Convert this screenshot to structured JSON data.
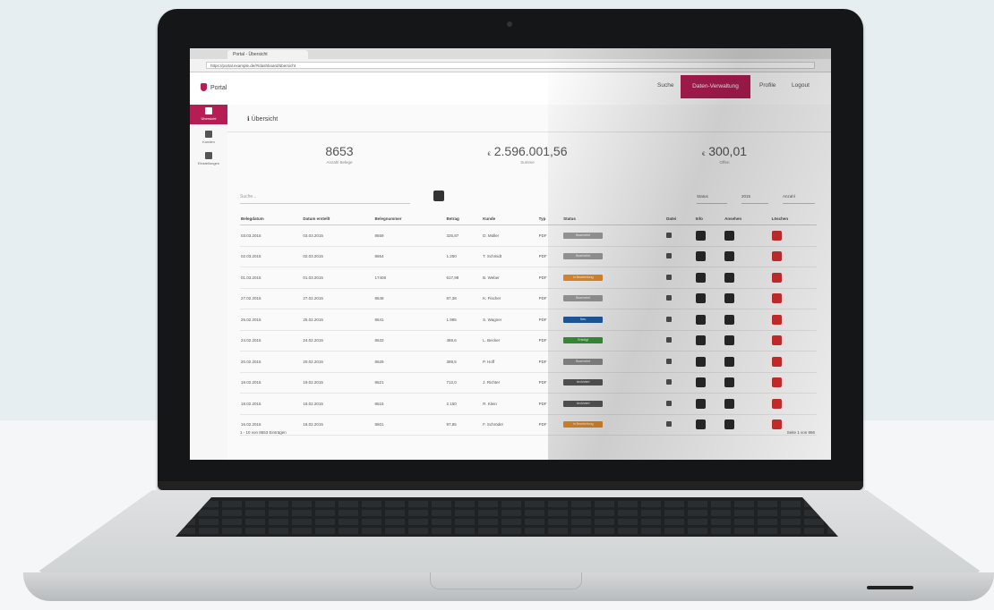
{
  "browser": {
    "tab_title": "Portal - Übersicht",
    "url": "https://portal.example.de/#/dashboard/übersicht"
  },
  "navbar": {
    "brand": "Portal",
    "links": [
      "Suche",
      "Daten-Verwaltung",
      "Profile",
      "Logout"
    ],
    "active_index": 1
  },
  "sidebar": {
    "items": [
      "Übersicht",
      "Kunden",
      "Einstellungen"
    ],
    "active_index": 0
  },
  "breadcrumb": "Übersicht",
  "stats": [
    {
      "value": "8653",
      "label": "Anzahl Belege"
    },
    {
      "value": "2.596.001,56",
      "label": "Summe",
      "prefix": "€"
    },
    {
      "value": "300,01",
      "label": "Offen",
      "prefix": "€"
    }
  ],
  "search": {
    "placeholder": "Suche..."
  },
  "filters": [
    "Status",
    "2015",
    "Anzahl"
  ],
  "table": {
    "columns": [
      "Belegdatum",
      "Datum erstellt",
      "Belegnummer",
      "Betrag",
      "Kunde",
      "Typ",
      "Status",
      "Datei",
      "Info",
      "Ansehen",
      "Löschen"
    ],
    "rows": [
      {
        "belegdatum": "03.03.2015",
        "erstellt": "03.03.2015",
        "nummer": "8659",
        "betrag": "325,87",
        "kunde": "D. Müller",
        "typ": "PDF",
        "status": "Bearbeitet",
        "status_color": "#9e9e9e"
      },
      {
        "belegdatum": "02.03.2015",
        "erstellt": "02.03.2015",
        "nummer": "8654",
        "betrag": "1.250",
        "kunde": "T. Schmidt",
        "typ": "PDF",
        "status": "Bearbeitet",
        "status_color": "#9e9e9e"
      },
      {
        "belegdatum": "01.03.2015",
        "erstellt": "01.03.2015",
        "nummer": "17408",
        "betrag": "617,98",
        "kunde": "B. Weber",
        "typ": "PDF",
        "status": "In Bearbeitung",
        "status_color": "#e8912d"
      },
      {
        "belegdatum": "27.02.2015",
        "erstellt": "27.02.2015",
        "nummer": "8648",
        "betrag": "87,38",
        "kunde": "K. Fischer",
        "typ": "PDF",
        "status": "Bearbeitet",
        "status_color": "#9e9e9e"
      },
      {
        "belegdatum": "25.02.2015",
        "erstellt": "25.02.2015",
        "nummer": "8641",
        "betrag": "1.985",
        "kunde": "S. Wagner",
        "typ": "PDF",
        "status": "Neu",
        "status_color": "#1f5fa8"
      },
      {
        "belegdatum": "24.02.2015",
        "erstellt": "24.02.2015",
        "nummer": "8633",
        "betrag": "469,6",
        "kunde": "L. Becker",
        "typ": "PDF",
        "status": "Erledigt",
        "status_color": "#3a9a3a"
      },
      {
        "belegdatum": "20.02.2015",
        "erstellt": "20.02.2015",
        "nummer": "8629",
        "betrag": "389,5",
        "kunde": "P. Hoff",
        "typ": "PDF",
        "status": "Bearbeitet",
        "status_color": "#8e8e8e"
      },
      {
        "belegdatum": "19.02.2015",
        "erstellt": "19.02.2015",
        "nummer": "8621",
        "betrag": "712,0",
        "kunde": "J. Richter",
        "typ": "PDF",
        "status": "Archiviert",
        "status_color": "#5a5a5a"
      },
      {
        "belegdatum": "18.02.2015",
        "erstellt": "18.02.2015",
        "nummer": "8615",
        "betrag": "2.150",
        "kunde": "R. Klein",
        "typ": "PDF",
        "status": "Archiviert",
        "status_color": "#5a5a5a"
      },
      {
        "belegdatum": "16.02.2015",
        "erstellt": "16.02.2015",
        "nummer": "8601",
        "betrag": "97,85",
        "kunde": "F. Schröder",
        "typ": "PDF",
        "status": "In Bearbeitung",
        "status_color": "#e8912d"
      }
    ]
  },
  "pagination": {
    "text": "1 - 10 von 8653 Einträgen",
    "page_label": "Seite 1 von 866"
  },
  "colors": {
    "accent": "#b51d55",
    "danger": "#d32f2f",
    "dark_button": "#2b2b2b"
  }
}
